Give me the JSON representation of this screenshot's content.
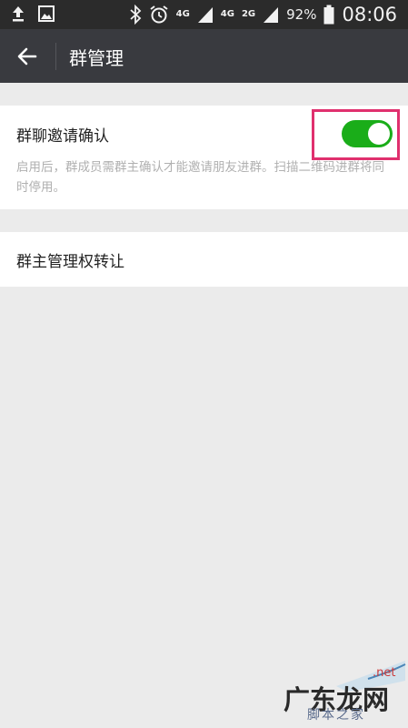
{
  "status_bar": {
    "network_4g": "4G",
    "network_4g_small": "4G",
    "network_2g": "2G",
    "battery": "92%",
    "time": "08:06",
    "icons": [
      "upload-icon",
      "image-icon",
      "bluetooth-icon",
      "alarm-icon",
      "signal-icon",
      "battery-icon"
    ]
  },
  "nav": {
    "title": "群管理",
    "back_icon": "back-arrow-icon"
  },
  "settings": {
    "invite_confirm": {
      "title": "群聊邀请确认",
      "description": "启用后，群成员需群主确认才能邀请朋友进群。扫描二维码进群将同时停用。",
      "toggle_on": true
    },
    "owner_transfer": {
      "title": "群主管理权转让"
    }
  },
  "watermark": {
    "net": ".net",
    "main": "广东龙网",
    "sub": "脚本之家"
  },
  "colors": {
    "nav_bg": "#393a3f",
    "toggle_on": "#1aad19",
    "highlight": "#e0306e",
    "page_bg": "#ebebeb"
  }
}
